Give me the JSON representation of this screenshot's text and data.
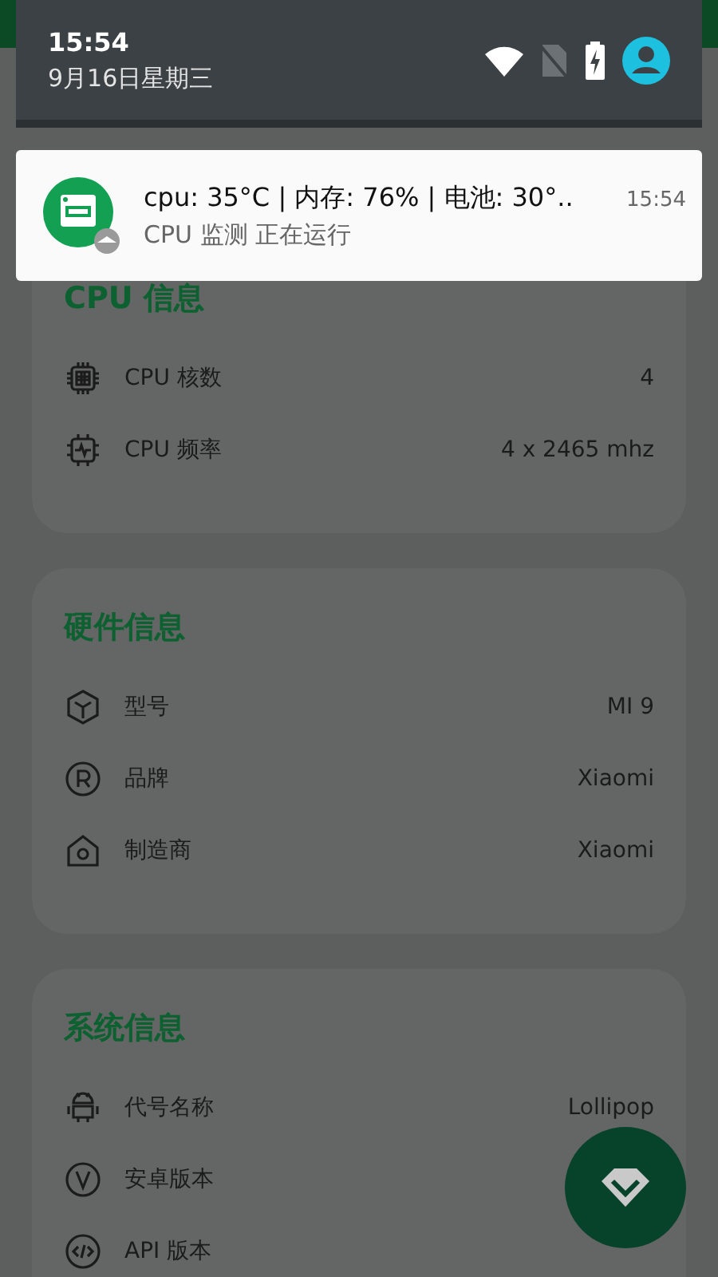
{
  "status_shade": {
    "time": "15:54",
    "date": "9月16日星期三"
  },
  "notification": {
    "title": "cpu: 35°C | 内存: 76% | 电池: 30°..",
    "time": "15:54",
    "text": "CPU 监测 正在运行"
  },
  "sections": [
    {
      "title": "CPU 信息",
      "rows": [
        {
          "label": "CPU 核数",
          "value": "4"
        },
        {
          "label": "CPU 频率",
          "value": "4 x 2465 mhz"
        }
      ]
    },
    {
      "title": "硬件信息",
      "rows": [
        {
          "label": "型号",
          "value": "MI 9"
        },
        {
          "label": "品牌",
          "value": "Xiaomi"
        },
        {
          "label": "制造商",
          "value": "Xiaomi"
        }
      ]
    },
    {
      "title": "系统信息",
      "rows": [
        {
          "label": "代号名称",
          "value": "Lollipop"
        },
        {
          "label": "安卓版本"
        },
        {
          "label": "API 版本"
        }
      ]
    }
  ]
}
